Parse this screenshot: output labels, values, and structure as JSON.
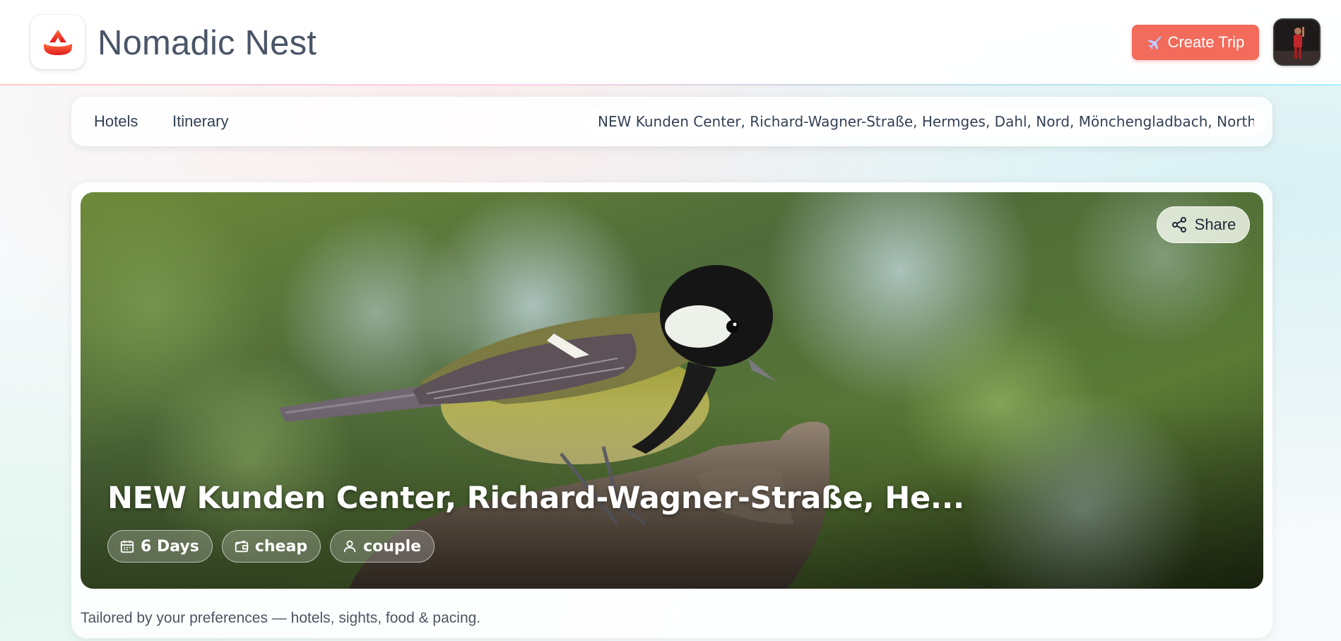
{
  "header": {
    "brand": "Nomadic Nest",
    "create_trip_label": "Create Trip",
    "accent": "#f26b5b"
  },
  "nav": {
    "tabs": [
      {
        "label": "Hotels"
      },
      {
        "label": "Itinerary"
      }
    ],
    "location_value": "NEW Kunden Center, Richard-Wagner-Straße, Hermges, Dahl, Nord, Mönchengladbach, North Rhine-Westphalia"
  },
  "hero": {
    "share_label": "Share",
    "title": "NEW Kunden Center, Richard-Wagner-Straße, He...",
    "chips": [
      {
        "icon": "calendar-icon",
        "label": "6 Days"
      },
      {
        "icon": "wallet-icon",
        "label": "cheap"
      },
      {
        "icon": "person-icon",
        "label": "couple"
      }
    ]
  },
  "tagline": "Tailored by your preferences — hotels, sights, food & pacing."
}
